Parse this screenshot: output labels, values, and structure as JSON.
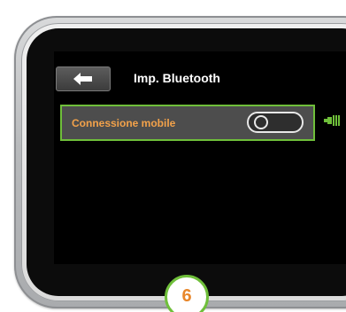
{
  "screen": {
    "title": "Imp. Bluetooth",
    "back_icon": "arrow-left-icon"
  },
  "setting": {
    "label": "Connessione mobile",
    "toggle_state": "off"
  },
  "status": {
    "icon": "cartridge-level-icon",
    "color": "#6fbf3a"
  },
  "step": {
    "number": "6"
  },
  "colors": {
    "accent_green": "#6fbf3a",
    "label_orange": "#f3a24a",
    "badge_orange": "#e8872b"
  }
}
